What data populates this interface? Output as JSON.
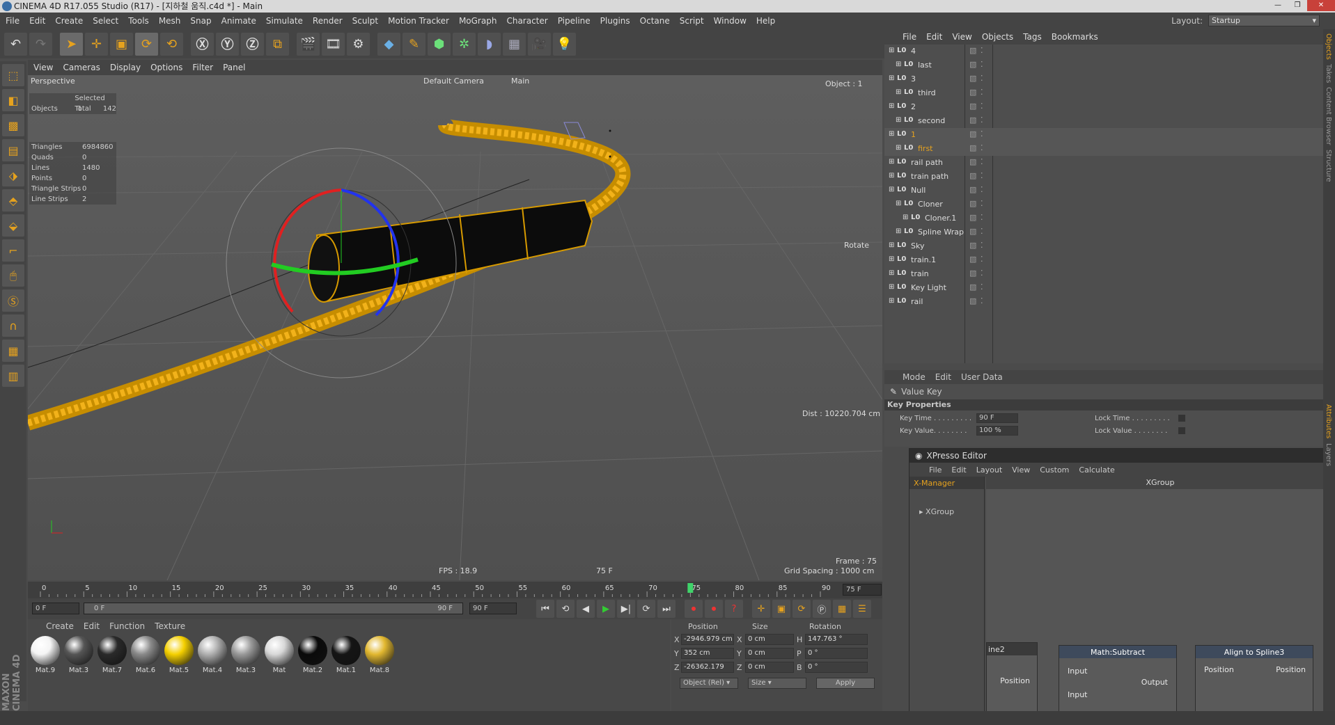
{
  "window": {
    "title": "CINEMA 4D R17.055 Studio (R17) - [지하철 움직.c4d *] - Main"
  },
  "menu": [
    "File",
    "Edit",
    "Create",
    "Select",
    "Tools",
    "Mesh",
    "Snap",
    "Animate",
    "Simulate",
    "Render",
    "Sculpt",
    "Motion Tracker",
    "MoGraph",
    "Character",
    "Pipeline",
    "Plugins",
    "Octane",
    "Script",
    "Window",
    "Help"
  ],
  "layout": {
    "label": "Layout:",
    "value": "Startup"
  },
  "viewport": {
    "menu": [
      "View",
      "Cameras",
      "Display",
      "Options",
      "Filter",
      "Panel"
    ],
    "name": "Perspective",
    "camera": "Default Camera",
    "main": "Main",
    "object_label": "Object : 1",
    "rotate_label": "Rotate",
    "dist": "Dist : 10220.704 cm",
    "fps": "FPS : 18.9",
    "frame_mid": "75 F",
    "frame": "Frame : 75",
    "grid": "Grid Spacing : 1000 cm",
    "stats_header": "Selected Total",
    "objects": {
      "label": "Objects",
      "selected": "1",
      "total": "142"
    },
    "stats": [
      {
        "k": "Triangles",
        "v": "6984860"
      },
      {
        "k": "Quads",
        "v": "0"
      },
      {
        "k": "Lines",
        "v": "1480"
      },
      {
        "k": "Points",
        "v": "0"
      },
      {
        "k": "Triangle Strips",
        "v": "0"
      },
      {
        "k": "Line Strips",
        "v": "2"
      }
    ]
  },
  "timeline": {
    "ticks": [
      "0",
      "5",
      "10",
      "15",
      "20",
      "25",
      "30",
      "35",
      "40",
      "45",
      "50",
      "55",
      "60",
      "65",
      "70",
      "75",
      "80",
      "85",
      "90"
    ],
    "current": 75,
    "max": 90,
    "current_label": "75 F",
    "start": "0 F",
    "range_start": "0 F",
    "range_end": "90 F",
    "end": "90 F"
  },
  "materials": {
    "menu": [
      "Create",
      "Edit",
      "Function",
      "Texture"
    ],
    "items": [
      {
        "name": "Mat.9",
        "color": "#f4f4f4"
      },
      {
        "name": "Mat.3",
        "color": "#555555"
      },
      {
        "name": "Mat.7",
        "color": "#2a2a2a"
      },
      {
        "name": "Mat.6",
        "color": "#8a8a8a"
      },
      {
        "name": "Mat.5",
        "color": "#f5d000"
      },
      {
        "name": "Mat.4",
        "color": "#b0b0b0"
      },
      {
        "name": "Mat.3",
        "color": "#9a9a9a"
      },
      {
        "name": "Mat",
        "color": "#d8d8d8"
      },
      {
        "name": "Mat.2",
        "color": "#0a0a0a"
      },
      {
        "name": "Mat.1",
        "color": "#151515"
      },
      {
        "name": "Mat.8",
        "color": "#e2b830"
      }
    ]
  },
  "coords": {
    "headers": [
      "Position",
      "Size",
      "Rotation"
    ],
    "rows": [
      {
        "axis": "X",
        "pos": "-2946.979 cm",
        "saxis": "X",
        "size": "0 cm",
        "raxis": "H",
        "rot": "147.763 °"
      },
      {
        "axis": "Y",
        "pos": "352 cm",
        "saxis": "Y",
        "size": "0 cm",
        "raxis": "P",
        "rot": "0 °"
      },
      {
        "axis": "Z",
        "pos": "-26362.179 cm",
        "saxis": "Z",
        "size": "0 cm",
        "raxis": "B",
        "rot": "0 °"
      }
    ],
    "mode": "Object (Rel)",
    "size_mode": "Size",
    "apply": "Apply"
  },
  "objects": {
    "menu": [
      "File",
      "Edit",
      "View",
      "Objects",
      "Tags",
      "Bookmarks"
    ],
    "rows": [
      {
        "name": "4",
        "indent": 0,
        "color": "#ddd"
      },
      {
        "name": "last",
        "indent": 1,
        "color": "#ddd"
      },
      {
        "name": "3",
        "indent": 0,
        "color": "#ddd"
      },
      {
        "name": "third",
        "indent": 1,
        "color": "#ddd"
      },
      {
        "name": "2",
        "indent": 0,
        "color": "#ddd"
      },
      {
        "name": "second",
        "indent": 1,
        "color": "#ddd"
      },
      {
        "name": "1",
        "indent": 0,
        "color": "#e6a21e"
      },
      {
        "name": "first",
        "indent": 1,
        "color": "#e6a21e"
      },
      {
        "name": "rail path",
        "indent": 0,
        "color": "#ddd"
      },
      {
        "name": "train path",
        "indent": 0,
        "color": "#ddd"
      },
      {
        "name": "Null",
        "indent": 0,
        "color": "#ddd"
      },
      {
        "name": "Cloner",
        "indent": 1,
        "color": "#ddd"
      },
      {
        "name": "Cloner.1",
        "indent": 2,
        "color": "#ddd"
      },
      {
        "name": "Spline Wrap",
        "indent": 1,
        "color": "#ddd"
      },
      {
        "name": "Sky",
        "indent": 0,
        "color": "#ddd"
      },
      {
        "name": "train.1",
        "indent": 0,
        "color": "#ddd"
      },
      {
        "name": "train",
        "indent": 0,
        "color": "#ddd"
      },
      {
        "name": "Key Light",
        "indent": 0,
        "color": "#ddd"
      },
      {
        "name": "rail",
        "indent": 0,
        "color": "#ddd"
      }
    ]
  },
  "attributes": {
    "menu": [
      "Mode",
      "Edit",
      "User Data"
    ],
    "title": "Value Key",
    "section": "Key Properties",
    "key_time_label": "Key Time . . . . . . . . .",
    "key_time": "90 F",
    "key_value_label": "Key Value. . . . . . . .",
    "key_value": "100 %",
    "lock_time": "Lock Time . . . . . . . . .",
    "lock_value": "Lock Value . . . . . . . ."
  },
  "xpresso": {
    "title": "XPresso Editor",
    "menu": [
      "File",
      "Edit",
      "Layout",
      "View",
      "Custom",
      "Calculate"
    ],
    "tab": "X-Manager",
    "tree_item": "XGroup",
    "group_title": "XGroup",
    "nodes": {
      "spline_partial": "ine2",
      "spline_port": "Position",
      "math": "Math:Subtract",
      "math_in1": "Input",
      "math_in2": "Input",
      "math_out": "Output",
      "align": "Align to Spline3",
      "align_in": "Position",
      "align_out": "Position"
    }
  },
  "right_tabs": [
    "Objects",
    "Takes",
    "Content Browser",
    "Structure",
    "Attributes",
    "Layers"
  ],
  "brand": "MAXON CINEMA 4D"
}
